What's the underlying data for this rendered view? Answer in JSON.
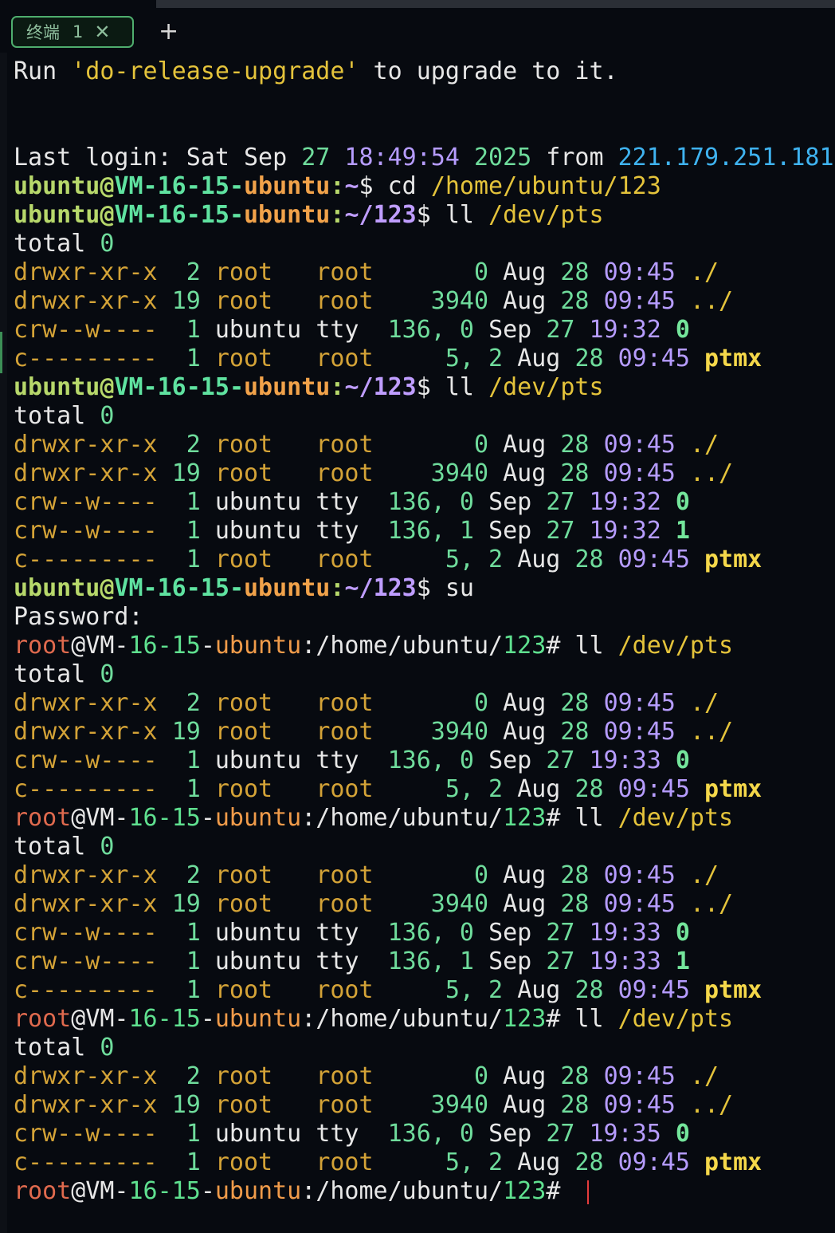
{
  "tab": {
    "label": "终端",
    "number": "1",
    "close_glyph": "✕",
    "add_glyph": "+"
  },
  "terminal": {
    "upgrade_line": "Run 'do-release-upgrade' to upgrade to it.",
    "last_login": {
      "prefix": "Last login: Sat Sep ",
      "day": "27",
      "time": "18:49:54",
      "year": "2025",
      "from": "from",
      "ip": "221.179.251.181"
    },
    "user_prompt": {
      "user": "ubuntu",
      "at": "@",
      "host_a": "VM-",
      "host_b": "16-15",
      "host_c": "-",
      "host_d": "ubuntu",
      "colon": ":"
    },
    "root_prompt": {
      "user": "root",
      "at": "@",
      "host_a": "VM-",
      "host_b": "16-15",
      "host_c": "-",
      "host_d": "ubuntu",
      "colon": ":"
    },
    "commands": {
      "cd": "cd",
      "cd_path": "/home/ubuntu/123",
      "ll": "ll",
      "pts": "/dev/pts",
      "su": "su",
      "password": "Password:"
    },
    "total": "total",
    "zero": "0",
    "rows": {
      "dot": {
        "perm": "drwxr-xr-x",
        "links": " 2",
        "user": "root  ",
        "group": "root  ",
        "size": "    0",
        "month": "Aug",
        "day": "28",
        "time": "09:45",
        "name": "./"
      },
      "dotdot": {
        "perm": "drwxr-xr-x",
        "links": "19",
        "user": "root  ",
        "group": "root  ",
        "size": " 3940",
        "month": "Aug",
        "day": "28",
        "time": "09:45",
        "name": "../"
      },
      "ptmx": {
        "perm": "c---------",
        "links": " 1",
        "user": "root  ",
        "group": "root  ",
        "size": "  5, 2",
        "month": "Aug",
        "day": "28",
        "time": "09:45",
        "name": "ptmx"
      }
    },
    "tty_rows": [
      {
        "perm": "crw--w----",
        "links": " 1",
        "user": "ubuntu",
        "group": "tty ",
        "size": "136, 0",
        "month": "Sep",
        "day": "27",
        "time": "19:32",
        "name": "0"
      },
      {
        "perm": "crw--w----",
        "links": " 1",
        "user": "ubuntu",
        "group": "tty ",
        "size": "136, 1",
        "month": "Sep",
        "day": "27",
        "time": "19:32",
        "name": "1"
      },
      {
        "perm": "crw--w----",
        "links": " 1",
        "user": "ubuntu",
        "group": "tty ",
        "size": "136, 0",
        "month": "Sep",
        "day": "27",
        "time": "19:33",
        "name": "0"
      },
      {
        "perm": "crw--w----",
        "links": " 1",
        "user": "ubuntu",
        "group": "tty ",
        "size": "136, 1",
        "month": "Sep",
        "day": "27",
        "time": "19:33",
        "name": "1"
      },
      {
        "perm": "crw--w----",
        "links": " 1",
        "user": "ubuntu",
        "group": "tty ",
        "size": "136, 0",
        "month": "Sep",
        "day": "27",
        "time": "19:35",
        "name": "0"
      }
    ]
  }
}
